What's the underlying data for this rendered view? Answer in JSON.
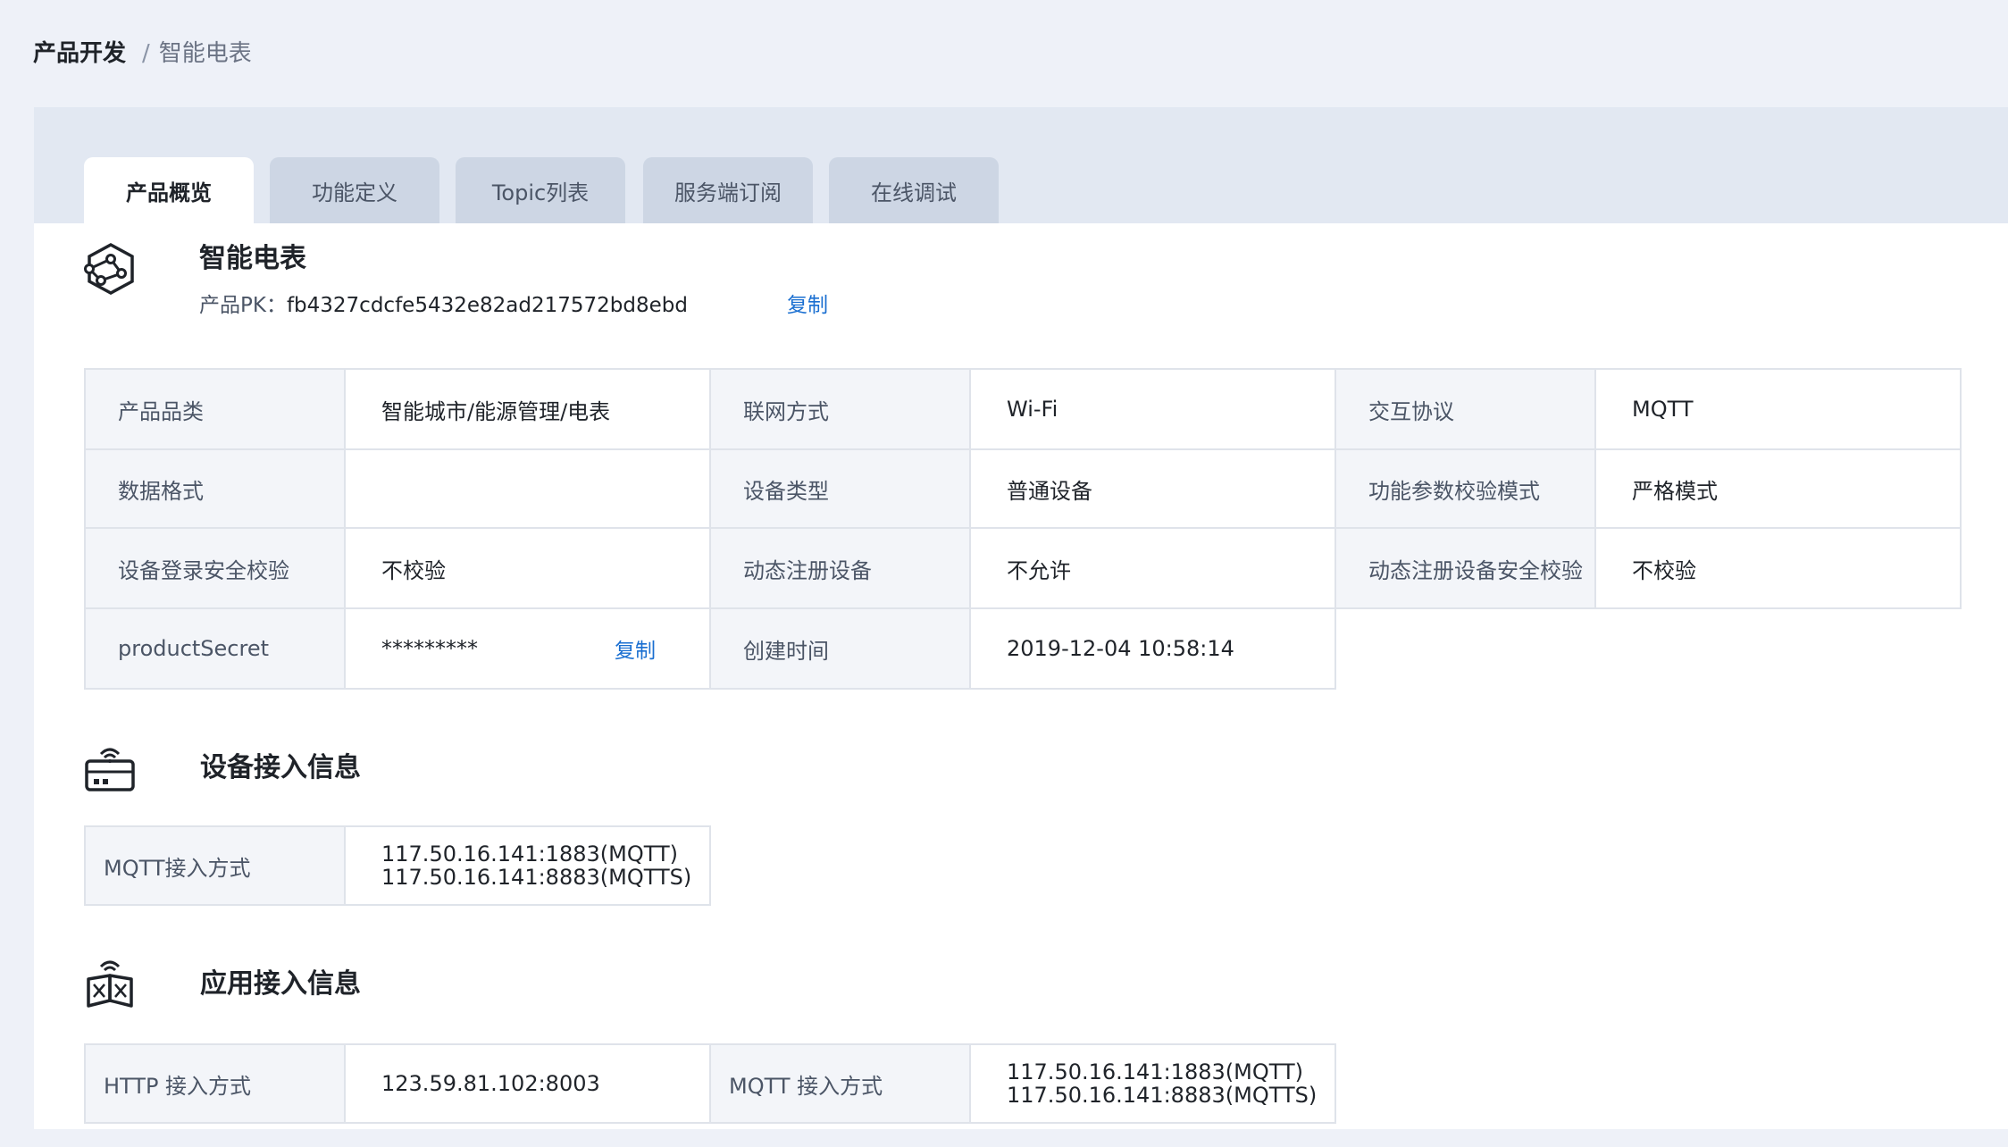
{
  "breadcrumb": {
    "root": "产品开发",
    "separator": "/",
    "current": "智能电表"
  },
  "tabs": [
    {
      "label": "产品概览",
      "active": true
    },
    {
      "label": "功能定义",
      "active": false
    },
    {
      "label": "Topic列表",
      "active": false
    },
    {
      "label": "服务端订阅",
      "active": false
    },
    {
      "label": "在线调试",
      "active": false
    }
  ],
  "product": {
    "name": "智能电表",
    "pk_label": "产品PK：",
    "pk_value": "fb4327cdcfe5432e82ad217572bd8ebd",
    "copy_label": "复制",
    "icon": "hexagon-node-icon"
  },
  "info": {
    "category_label": "产品品类",
    "category_value": "智能城市/能源管理/电表",
    "network_label": "联网方式",
    "network_value": "Wi-Fi",
    "protocol_label": "交互协议",
    "protocol_value": "MQTT",
    "data_format_label": "数据格式",
    "data_format_value": "",
    "device_type_label": "设备类型",
    "device_type_value": "普通设备",
    "param_mode_label": "功能参数校验模式",
    "param_mode_value": "严格模式",
    "login_check_label": "设备登录安全校验",
    "login_check_value": "不校验",
    "dyn_reg_label": "动态注册设备",
    "dyn_reg_value": "不允许",
    "dyn_reg_check_label": "动态注册设备安全校验",
    "dyn_reg_check_value": "不校验",
    "secret_label": "productSecret",
    "secret_value": "*********",
    "secret_copy": "复制",
    "created_label": "创建时间",
    "created_value": "2019-12-04 10:58:14"
  },
  "device_access": {
    "title": "设备接入信息",
    "icon": "router-icon",
    "mqtt_label": "MQTT接入方式",
    "mqtt_line1": "117.50.16.141:1883(MQTT)",
    "mqtt_line2": "117.50.16.141:8883(MQTTS)"
  },
  "app_access": {
    "title": "应用接入信息",
    "icon": "open-book-icon",
    "http_label": "HTTP 接入方式",
    "http_value": "123.59.81.102:8003",
    "mqtt_label": "MQTT 接入方式",
    "mqtt_line1": "117.50.16.141:1883(MQTT)",
    "mqtt_line2": "117.50.16.141:8883(MQTTS)"
  },
  "colors": {
    "background": "#eef1f8",
    "tab_bar": "#e2e8f2",
    "tab_inactive": "#cdd6e4",
    "link": "#1a6fd1",
    "label_cell": "#f3f5f9",
    "border": "#dfe3ea"
  }
}
